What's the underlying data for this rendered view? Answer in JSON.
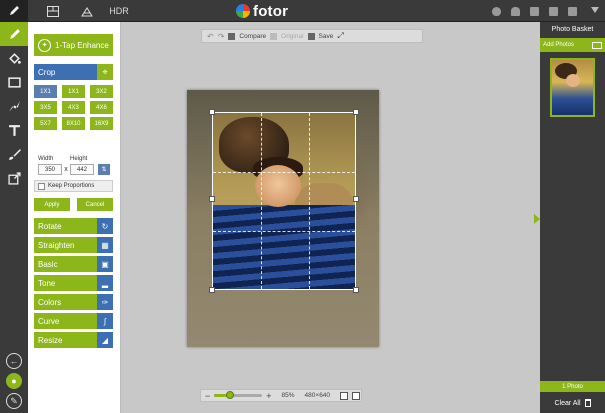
{
  "topbar": {
    "hdr_label": "HDR",
    "logo_text": "fotor"
  },
  "left_tools": [
    "pencil-icon",
    "paint-bucket-icon",
    "frame-icon",
    "sticker-icon",
    "text-icon",
    "brush-icon",
    "export-icon"
  ],
  "panel": {
    "enhance_label": "1-Tap Enhance",
    "crop_label": "Crop",
    "ratios": [
      "1X1",
      "1X1",
      "3X2",
      "3X5",
      "4X3",
      "4X6",
      "5X7",
      "8X10",
      "16X9"
    ],
    "width_label": "Width",
    "height_label": "Height",
    "width_value": "350",
    "height_value": "442",
    "times": "x",
    "keep_proportions": "Keep Proportions",
    "apply_label": "Apply",
    "cancel_label": "Cancel",
    "tools": [
      "Rotate",
      "Straighten",
      "Basic",
      "Tone",
      "Colors",
      "Curve",
      "Resize"
    ]
  },
  "canvas": {
    "compare_label": "Compare",
    "original_label": "Original",
    "save_label": "Save",
    "zoom_percent": "85%",
    "dimensions": "480×640",
    "zoom_level": 0.3
  },
  "basket": {
    "title": "Photo Basket",
    "add_photos": "Add Photos",
    "count": "1 Photo",
    "clear_all": "Clear All"
  },
  "colors": {
    "accent_green": "#8cb61a",
    "accent_blue": "#3d6fb3",
    "dark_chrome": "#3a3a3a"
  }
}
